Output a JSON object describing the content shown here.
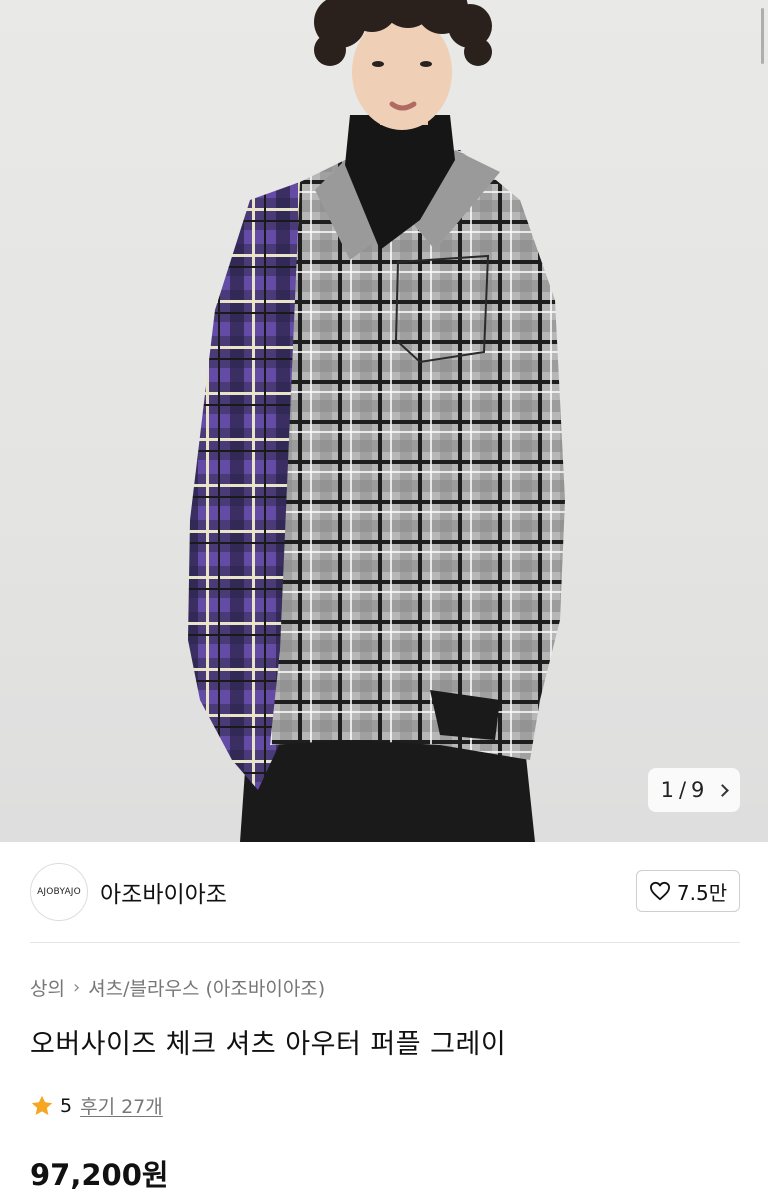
{
  "gallery": {
    "current": "1",
    "separator": "/",
    "total": "9",
    "next_icon": "chevron-right-icon"
  },
  "shop": {
    "logo_text": "AJOBYAJO",
    "name": "아조바이아조",
    "like_count": "7.5만",
    "like_icon": "heart-outline-icon"
  },
  "product": {
    "breadcrumb": [
      "상의",
      "셔츠/블라우스 (아조바이아조)"
    ],
    "title": "오버사이즈 체크 셔츠 아우터 퍼플 그레이",
    "rating": "5",
    "reviews_label": "후기 27개",
    "price": "97,200원"
  },
  "colors": {
    "star": "#F5A623",
    "text_primary": "#111111",
    "text_secondary": "#777777",
    "divider": "#E5E5E5"
  }
}
